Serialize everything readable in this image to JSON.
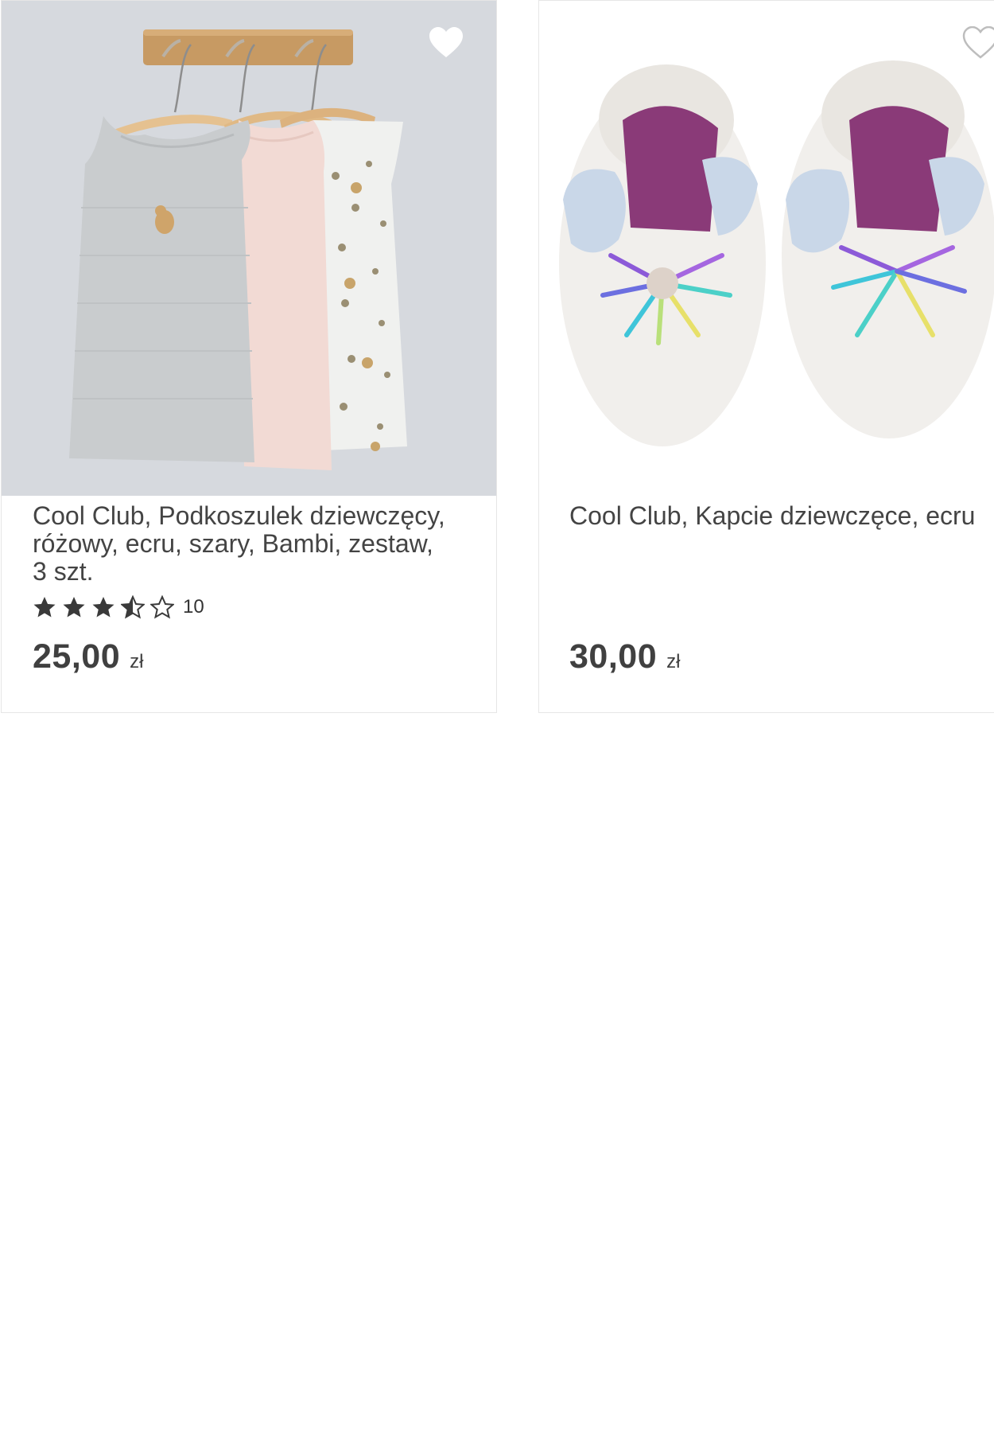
{
  "products": [
    {
      "title": "Cool Club, Podkoszulek dziewczęcy, różowy, ecru, szary, Bambi, zestaw, 3 szt.",
      "rating": 3.5,
      "rating_max": 5,
      "review_count": "10",
      "price": "25,00",
      "currency": "zł",
      "favorite_icon": "heart-outline-icon"
    },
    {
      "title": "Cool Club, Kapcie dziewczęce, ecru",
      "price": "30,00",
      "currency": "zł",
      "favorite_icon": "heart-outline-icon"
    }
  ]
}
